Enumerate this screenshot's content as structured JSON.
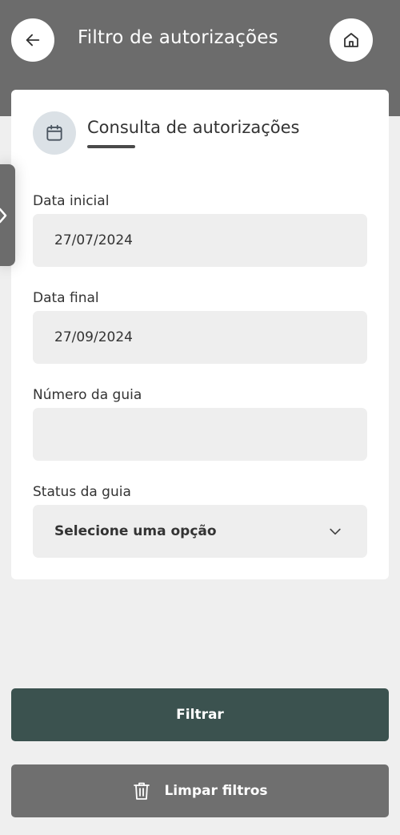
{
  "header": {
    "title": "Filtro de autorizações",
    "back_icon": "arrow-left-icon",
    "home_icon": "home-icon"
  },
  "card": {
    "title": "Consulta de autorizações",
    "icon": "calendar-icon"
  },
  "fields": {
    "start_date": {
      "label": "Data inicial",
      "value": "27/07/2024"
    },
    "end_date": {
      "label": "Data final",
      "value": "27/09/2024"
    },
    "guide_number": {
      "label": "Número da guia",
      "value": ""
    },
    "guide_status": {
      "label": "Status da guia",
      "value": "Selecione uma opção"
    }
  },
  "buttons": {
    "filter_label": "Filtrar",
    "clear_label": "Limpar filtros",
    "clear_icon": "trash-icon"
  },
  "side_tab": {
    "icon": "chevron-right-icon"
  },
  "colors": {
    "header_bg": "#6c6c6c",
    "filter_button": "#3b524f",
    "clear_button": "#6f6f6f",
    "page_bg": "#efefef"
  }
}
